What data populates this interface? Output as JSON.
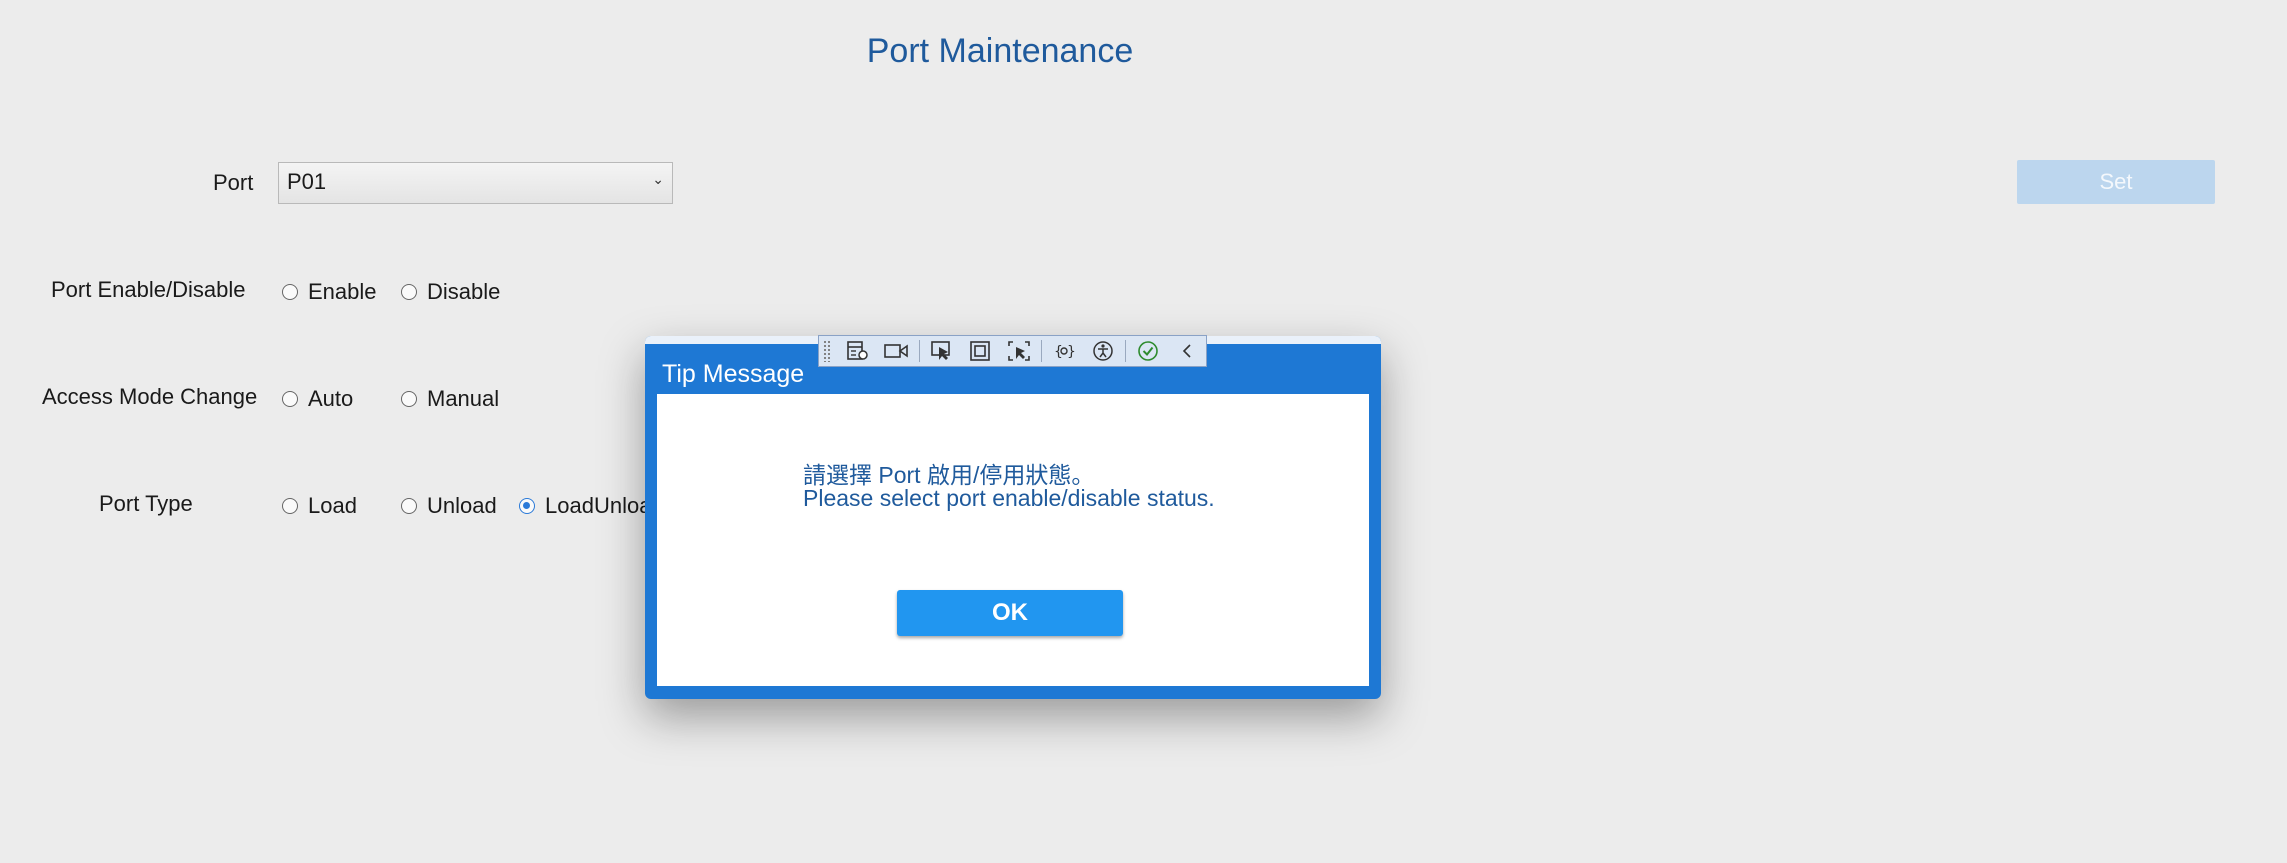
{
  "page": {
    "title": "Port Maintenance"
  },
  "form": {
    "port_label": "Port",
    "port_value": "P01",
    "set_label": "Set",
    "enable_label": "Port Enable/Disable",
    "enable_options": [
      "Enable",
      "Disable"
    ],
    "access_label": "Access Mode Change",
    "access_options": [
      "Auto",
      "Manual"
    ],
    "type_label": "Port Type",
    "type_options": [
      "Load",
      "Unload",
      "LoadUnload"
    ],
    "type_selected": "LoadUnload"
  },
  "dialog": {
    "title": "Tip Message",
    "message_line1": "請選擇 Port 啟用/停用狀態。",
    "message_line2": "Please select port enable/disable status.",
    "ok_label": "OK"
  },
  "dev_toolbar": {
    "icons": [
      "live-visual-tree-icon",
      "video-record-icon",
      "select-element-icon",
      "display-layout-adorners-icon",
      "track-focus-icon",
      "binding-failures-icon",
      "accessibility-icon",
      "hot-reload-ok-icon",
      "collapse-icon"
    ]
  },
  "colors": {
    "accent": "#1e78d4",
    "title": "#1f5a9c",
    "ok_button": "#2196f0",
    "set_disabled": "#bcd6ee"
  }
}
